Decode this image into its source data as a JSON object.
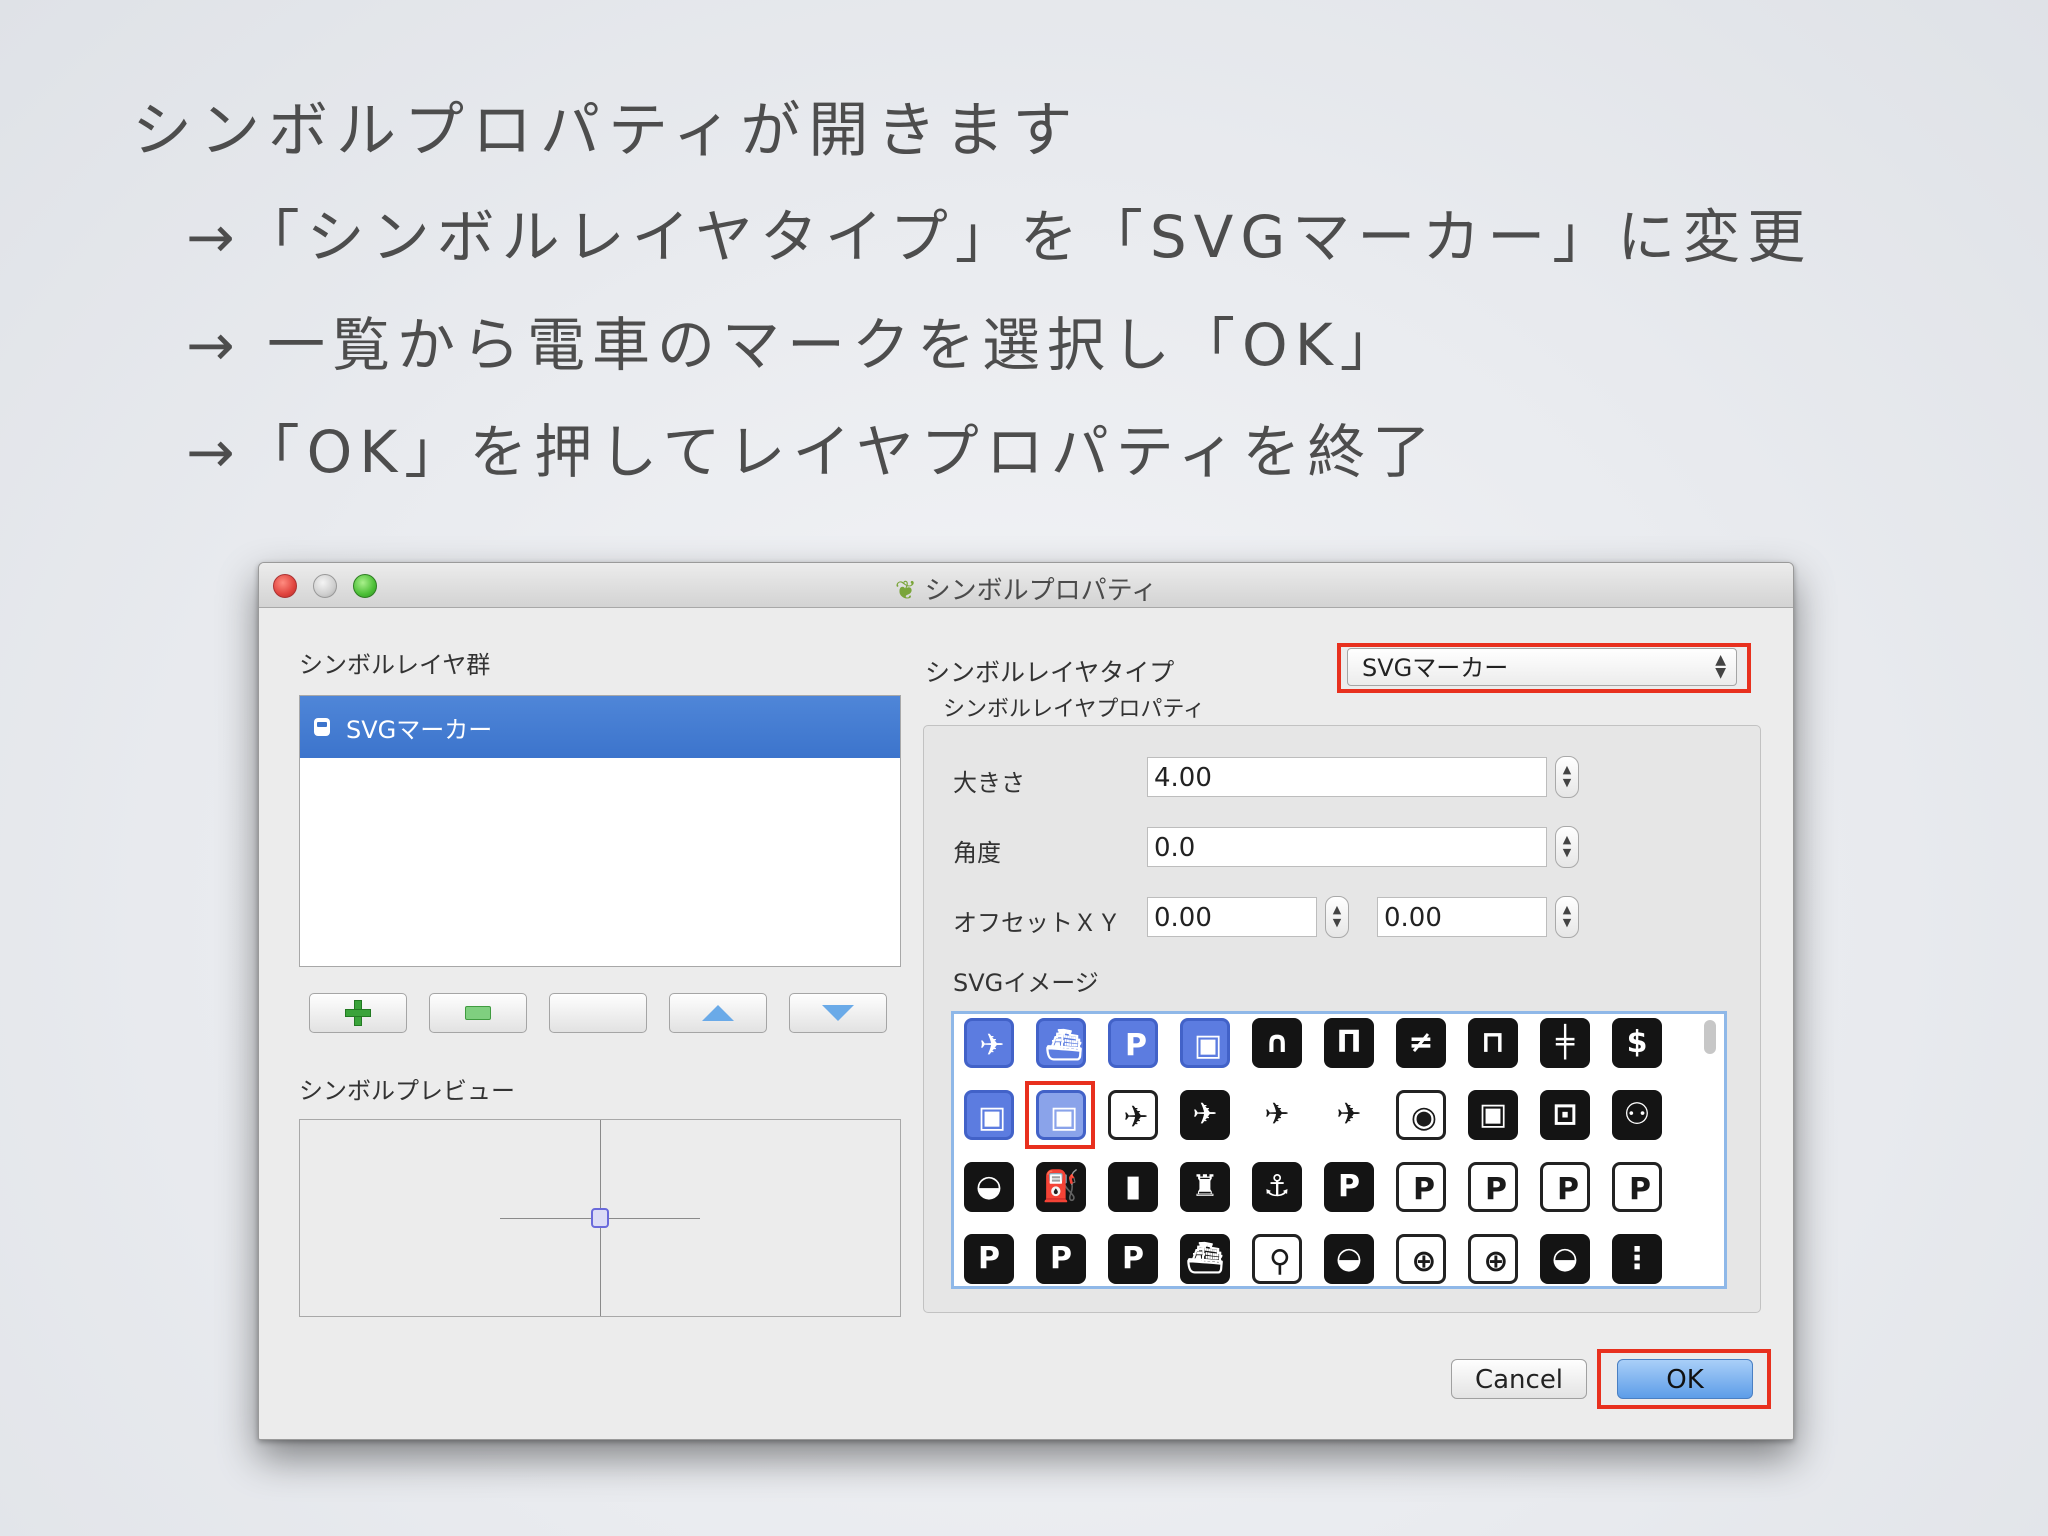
{
  "slide": {
    "title": "シンボルプロパティが開きます",
    "bullets": [
      "→「シンボルレイヤタイプ」を「SVGマーカー」に変更",
      "→ 一覧から電車のマークを選択し「OK」",
      "→「OK」を押してレイヤプロパティを終了"
    ]
  },
  "window": {
    "title": "シンボルプロパティ",
    "left": {
      "layers_label": "シンボルレイヤ群",
      "layer_item": "SVGマーカー",
      "preview_label": "シンボルプレビュー"
    },
    "right": {
      "type_label": "シンボルレイヤタイプ",
      "type_value": "SVGマーカー",
      "props_label": "シンボルレイヤプロパティ",
      "size_label": "大きさ",
      "size_value": "4.00",
      "angle_label": "角度",
      "angle_value": "0.0",
      "offset_label": "オフセットＸＹ",
      "offset_x": "0.00",
      "offset_y": "0.00",
      "svg_label": "SVGイメージ"
    },
    "buttons": {
      "cancel": "Cancel",
      "ok": "OK"
    }
  },
  "colors": {
    "highlight_red": "#e8301e",
    "selection_blue": "#3c74cc",
    "accent_blue": "#5c7ce0"
  },
  "svg_icons": [
    [
      "airport-icon",
      "ferry-icon",
      "parking-icon",
      "bus-front-icon",
      "tunnel-icon",
      "bridge-icon",
      "not-equal-icon",
      "barrier-icon",
      "rail-crossing-icon",
      "toll-icon"
    ],
    [
      "bus-icon",
      "train-icon",
      "airplane-outline-icon",
      "airplane-icon",
      "airplane-black-icon",
      "airplane-white-icon",
      "bus-circle-icon",
      "bus-black-icon",
      "bus-stop-icon",
      "people-icon"
    ],
    [
      "car-icon",
      "fuel-icon",
      "lpg-icon",
      "lighthouse-icon",
      "anchor-icon",
      "parking-black-icon",
      "parking-bike-icon",
      "parking-car-icon",
      "parking-paid-icon",
      "parking-disabled-icon"
    ],
    [
      "parking-outline-icon",
      "parking-black2-icon",
      "parking-dark-icon",
      "ship-icon",
      "bike-rental-icon",
      "car-rental-icon",
      "target-icon",
      "target2-icon",
      "taxi-icon",
      "traffic-light-icon"
    ]
  ]
}
